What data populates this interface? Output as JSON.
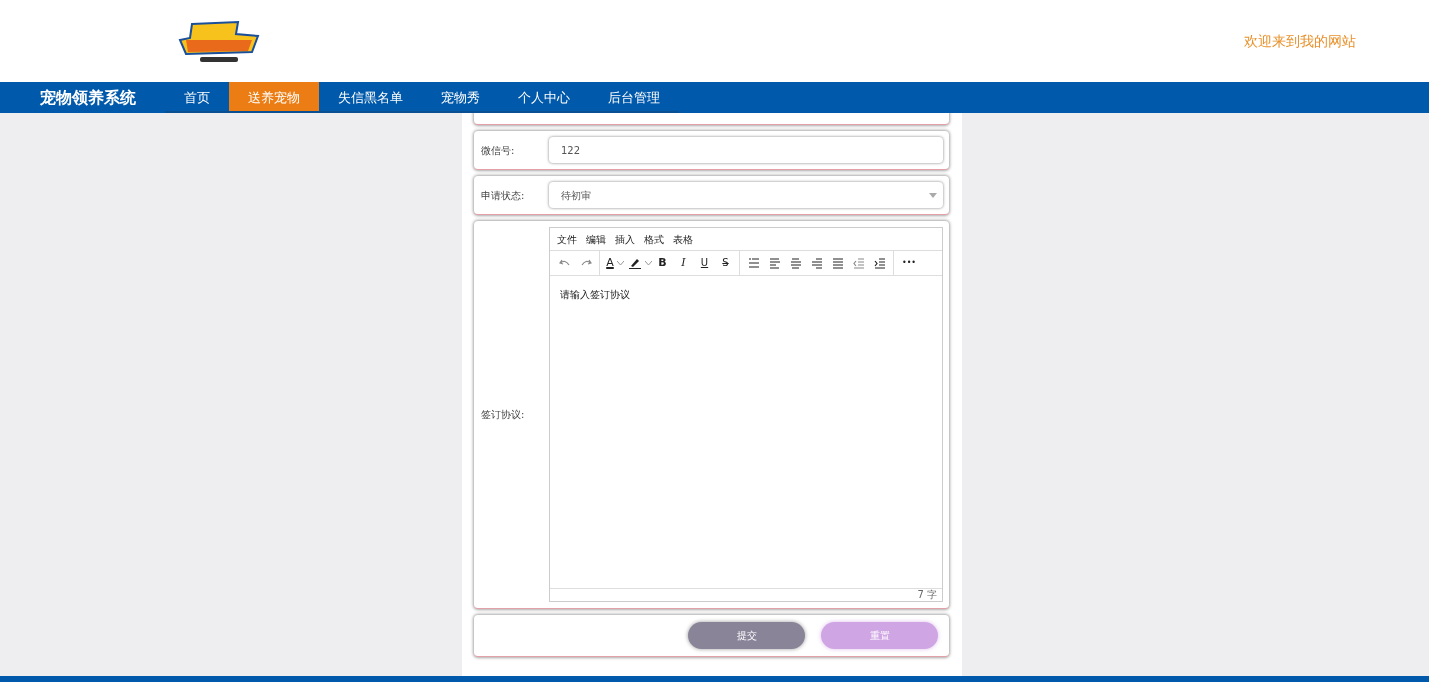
{
  "header": {
    "welcome": "欢迎来到我的网站"
  },
  "nav": {
    "brand": "宠物领养系统",
    "items": [
      {
        "label": "首页",
        "selected": false
      },
      {
        "label": "送养宠物",
        "selected": true
      },
      {
        "label": "失信黑名单",
        "selected": false
      },
      {
        "label": "宠物秀",
        "selected": false
      },
      {
        "label": "个人中心",
        "selected": false
      },
      {
        "label": "后台管理",
        "selected": false
      }
    ]
  },
  "form": {
    "fields": [
      {
        "kind": "text",
        "label": "微信号:",
        "value": "122"
      },
      {
        "kind": "select",
        "label": "申请状态:",
        "value": "待初审"
      }
    ],
    "agreement": {
      "label": "签订协议:",
      "menu": [
        "文件",
        "编辑",
        "插入",
        "格式",
        "表格"
      ],
      "toolbar": {
        "font_color": "A",
        "bold": "B",
        "italic": "I",
        "underline": "U",
        "strike": "S",
        "more": "•••"
      },
      "placeholder": "请输入签订协议",
      "word_count": "7 字"
    },
    "buttons": [
      {
        "kind": "submit",
        "label": "提交"
      },
      {
        "kind": "reset",
        "label": "重置"
      }
    ]
  }
}
